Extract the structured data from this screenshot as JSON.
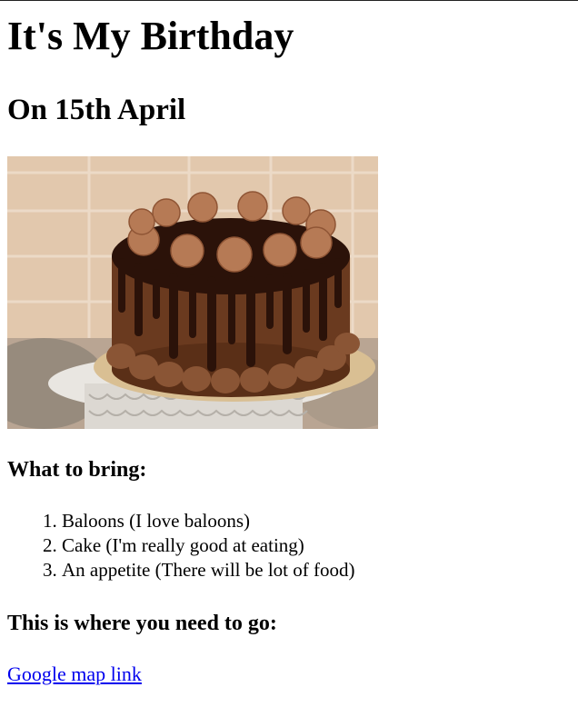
{
  "page": {
    "title": "It's My Birthday",
    "subtitle": "On 15th April",
    "bring_heading": "What to bring:",
    "bring_items": [
      "Baloons (I love baloons)",
      "Cake (I'm really good at eating)",
      "An appetite (There will be lot of food)"
    ],
    "go_heading": "This is where you need to go:",
    "map_link_text": "Google map link"
  },
  "image": {
    "subject": "chocolate-drip-cake"
  }
}
